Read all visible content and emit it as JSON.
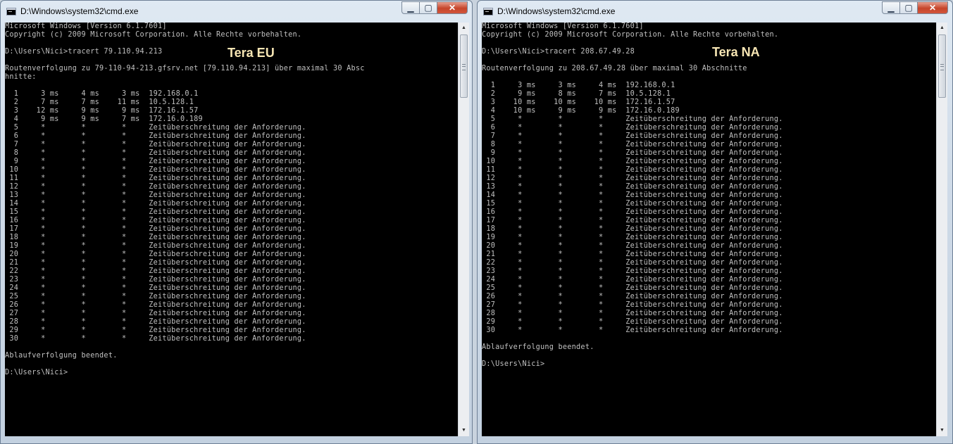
{
  "windows": [
    {
      "title": "D:\\Windows\\system32\\cmd.exe",
      "controls": {
        "minimize": "▁",
        "maximize": "▢",
        "close": "✕"
      },
      "overlay_label": "Tera EU",
      "lines": [
        "Microsoft Windows [Version 6.1.7601]",
        "Copyright (c) 2009 Microsoft Corporation. Alle Rechte vorbehalten.",
        "",
        "D:\\Users\\Nici>tracert 79.110.94.213",
        "",
        "Routenverfolgung zu 79-110-94-213.gfsrv.net [79.110.94.213] über maximal 30 Absc",
        "hnitte:",
        "",
        "  1     3 ms     4 ms     3 ms  192.168.0.1",
        "  2     7 ms     7 ms    11 ms  10.5.128.1",
        "  3    12 ms     9 ms     9 ms  172.16.1.57",
        "  4     9 ms     9 ms     7 ms  172.16.0.189",
        "  5     *        *        *     Zeitüberschreitung der Anforderung.",
        "  6     *        *        *     Zeitüberschreitung der Anforderung.",
        "  7     *        *        *     Zeitüberschreitung der Anforderung.",
        "  8     *        *        *     Zeitüberschreitung der Anforderung.",
        "  9     *        *        *     Zeitüberschreitung der Anforderung.",
        " 10     *        *        *     Zeitüberschreitung der Anforderung.",
        " 11     *        *        *     Zeitüberschreitung der Anforderung.",
        " 12     *        *        *     Zeitüberschreitung der Anforderung.",
        " 13     *        *        *     Zeitüberschreitung der Anforderung.",
        " 14     *        *        *     Zeitüberschreitung der Anforderung.",
        " 15     *        *        *     Zeitüberschreitung der Anforderung.",
        " 16     *        *        *     Zeitüberschreitung der Anforderung.",
        " 17     *        *        *     Zeitüberschreitung der Anforderung.",
        " 18     *        *        *     Zeitüberschreitung der Anforderung.",
        " 19     *        *        *     Zeitüberschreitung der Anforderung.",
        " 20     *        *        *     Zeitüberschreitung der Anforderung.",
        " 21     *        *        *     Zeitüberschreitung der Anforderung.",
        " 22     *        *        *     Zeitüberschreitung der Anforderung.",
        " 23     *        *        *     Zeitüberschreitung der Anforderung.",
        " 24     *        *        *     Zeitüberschreitung der Anforderung.",
        " 25     *        *        *     Zeitüberschreitung der Anforderung.",
        " 26     *        *        *     Zeitüberschreitung der Anforderung.",
        " 27     *        *        *     Zeitüberschreitung der Anforderung.",
        " 28     *        *        *     Zeitüberschreitung der Anforderung.",
        " 29     *        *        *     Zeitüberschreitung der Anforderung.",
        " 30     *        *        *     Zeitüberschreitung der Anforderung.",
        "",
        "Ablaufverfolgung beendet.",
        "",
        "D:\\Users\\Nici>"
      ]
    },
    {
      "title": "D:\\Windows\\system32\\cmd.exe",
      "controls": {
        "minimize": "▁",
        "maximize": "▢",
        "close": "✕"
      },
      "overlay_label": "Tera NA",
      "lines": [
        "Microsoft Windows [Version 6.1.7601]",
        "Copyright (c) 2009 Microsoft Corporation. Alle Rechte vorbehalten.",
        "",
        "D:\\Users\\Nici>tracert 208.67.49.28",
        "",
        "Routenverfolgung zu 208.67.49.28 über maximal 30 Abschnitte",
        "",
        "  1     3 ms     3 ms     4 ms  192.168.0.1",
        "  2     9 ms     8 ms     7 ms  10.5.128.1",
        "  3    10 ms    10 ms    10 ms  172.16.1.57",
        "  4    10 ms     9 ms     9 ms  172.16.0.189",
        "  5     *        *        *     Zeitüberschreitung der Anforderung.",
        "  6     *        *        *     Zeitüberschreitung der Anforderung.",
        "  7     *        *        *     Zeitüberschreitung der Anforderung.",
        "  8     *        *        *     Zeitüberschreitung der Anforderung.",
        "  9     *        *        *     Zeitüberschreitung der Anforderung.",
        " 10     *        *        *     Zeitüberschreitung der Anforderung.",
        " 11     *        *        *     Zeitüberschreitung der Anforderung.",
        " 12     *        *        *     Zeitüberschreitung der Anforderung.",
        " 13     *        *        *     Zeitüberschreitung der Anforderung.",
        " 14     *        *        *     Zeitüberschreitung der Anforderung.",
        " 15     *        *        *     Zeitüberschreitung der Anforderung.",
        " 16     *        *        *     Zeitüberschreitung der Anforderung.",
        " 17     *        *        *     Zeitüberschreitung der Anforderung.",
        " 18     *        *        *     Zeitüberschreitung der Anforderung.",
        " 19     *        *        *     Zeitüberschreitung der Anforderung.",
        " 20     *        *        *     Zeitüberschreitung der Anforderung.",
        " 21     *        *        *     Zeitüberschreitung der Anforderung.",
        " 22     *        *        *     Zeitüberschreitung der Anforderung.",
        " 23     *        *        *     Zeitüberschreitung der Anforderung.",
        " 24     *        *        *     Zeitüberschreitung der Anforderung.",
        " 25     *        *        *     Zeitüberschreitung der Anforderung.",
        " 26     *        *        *     Zeitüberschreitung der Anforderung.",
        " 27     *        *        *     Zeitüberschreitung der Anforderung.",
        " 28     *        *        *     Zeitüberschreitung der Anforderung.",
        " 29     *        *        *     Zeitüberschreitung der Anforderung.",
        " 30     *        *        *     Zeitüberschreitung der Anforderung.",
        "",
        "Ablaufverfolgung beendet.",
        "",
        "D:\\Users\\Nici>"
      ]
    }
  ],
  "icons": {
    "app": "cmd-console-icon",
    "scroll_up": "▲",
    "scroll_down": "▼"
  },
  "colors": {
    "console_bg": "#000000",
    "console_text": "#c0c0c0",
    "overlay_label": "#f7e6b4",
    "close_button": "#c6452b"
  }
}
